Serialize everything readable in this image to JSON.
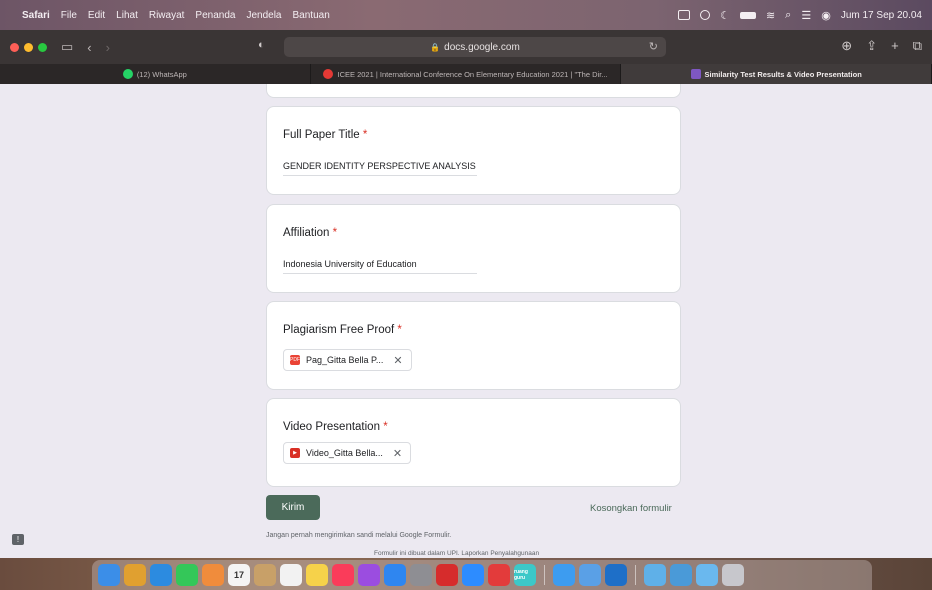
{
  "menubar": {
    "items": [
      "Safari",
      "File",
      "Edit",
      "Lihat",
      "Riwayat",
      "Penanda",
      "Jendela",
      "Bantuan"
    ],
    "clock": "Jum 17 Sep 20.04"
  },
  "browser": {
    "url": "docs.google.com",
    "tabs": [
      {
        "label": "(12) WhatsApp",
        "icon": "whatsapp-icon",
        "color": "#25d366"
      },
      {
        "label": "ICEE 2021 | International Conference On Elementary Education 2021 | \"The Dir...",
        "icon": "icee-icon",
        "color": "#e53935"
      },
      {
        "label": "Similarity Test Results & Video Presentation",
        "icon": "forms-icon",
        "color": "#7e57c2"
      }
    ],
    "active_tab": 2
  },
  "form": {
    "fields": [
      {
        "label": "Full Paper Title",
        "required_mark": "*",
        "value": "GENDER IDENTITY PERSPECTIVE ANALYSIS O"
      },
      {
        "label": "Affiliation",
        "required_mark": "*",
        "value": "Indonesia University of Education"
      },
      {
        "label": "Plagiarism Free Proof",
        "required_mark": "*",
        "file_name": "Pag_Gitta Bella P...",
        "file_type": "pdf",
        "file_color": "#ea4335"
      },
      {
        "label": "Video Presentation",
        "required_mark": "*",
        "file_name": "Video_Gitta Bella...",
        "file_type": "video",
        "file_color": "#d93025"
      }
    ],
    "submit_label": "Kirim",
    "clear_label": "Kosongkan formulir",
    "footer_note": "Jangan pernah mengirimkan sandi melalui Google Formulir.",
    "footer_note2": "Formulir ini dibuat dalam UPI. Laporkan Penyalahgunaan"
  },
  "colors": {
    "accent": "#4b6a5a",
    "required": "#d93025",
    "page_bg": "#ece9f1"
  },
  "dock": {
    "apps": [
      {
        "name": "finder-icon",
        "color": "#3b8ee8"
      },
      {
        "name": "launchpad-icon",
        "color": "#e0a030"
      },
      {
        "name": "safari-icon",
        "color": "#2c8be0"
      },
      {
        "name": "messages-icon",
        "color": "#34c759"
      },
      {
        "name": "photos-icon",
        "color": "#f08c3c"
      },
      {
        "name": "calendar-icon",
        "color": "#f4f4f4",
        "text": "17"
      },
      {
        "name": "contacts-icon",
        "color": "#c8a068"
      },
      {
        "name": "reminders-icon",
        "color": "#f2f2f2"
      },
      {
        "name": "notes-icon",
        "color": "#f6d24a"
      },
      {
        "name": "music-icon",
        "color": "#fa3c5a"
      },
      {
        "name": "podcasts-icon",
        "color": "#9b4de0"
      },
      {
        "name": "appstore-icon",
        "color": "#2f86f0"
      },
      {
        "name": "settings-icon",
        "color": "#8e8e93"
      },
      {
        "name": "photo-booth-icon",
        "color": "#d62c2c"
      },
      {
        "name": "zoom-icon",
        "color": "#2d8cff"
      },
      {
        "name": "wps-icon",
        "color": "#e33b3b"
      },
      {
        "name": "ruangguru-icon",
        "color": "#3cc8c8",
        "text": "ruang guru"
      },
      {
        "name": "mail-icon",
        "color": "#3d9cf0"
      },
      {
        "name": "preview-icon",
        "color": "#5aa0e6"
      },
      {
        "name": "quicktime-icon",
        "color": "#1e6fc8"
      },
      {
        "name": "folder-downloads-icon",
        "color": "#5fb0e8"
      },
      {
        "name": "folder-stack-icon",
        "color": "#4a9ad8"
      },
      {
        "name": "folder-docs-icon",
        "color": "#6ab8ee"
      },
      {
        "name": "trash-icon",
        "color": "#c7c7cc"
      }
    ]
  }
}
